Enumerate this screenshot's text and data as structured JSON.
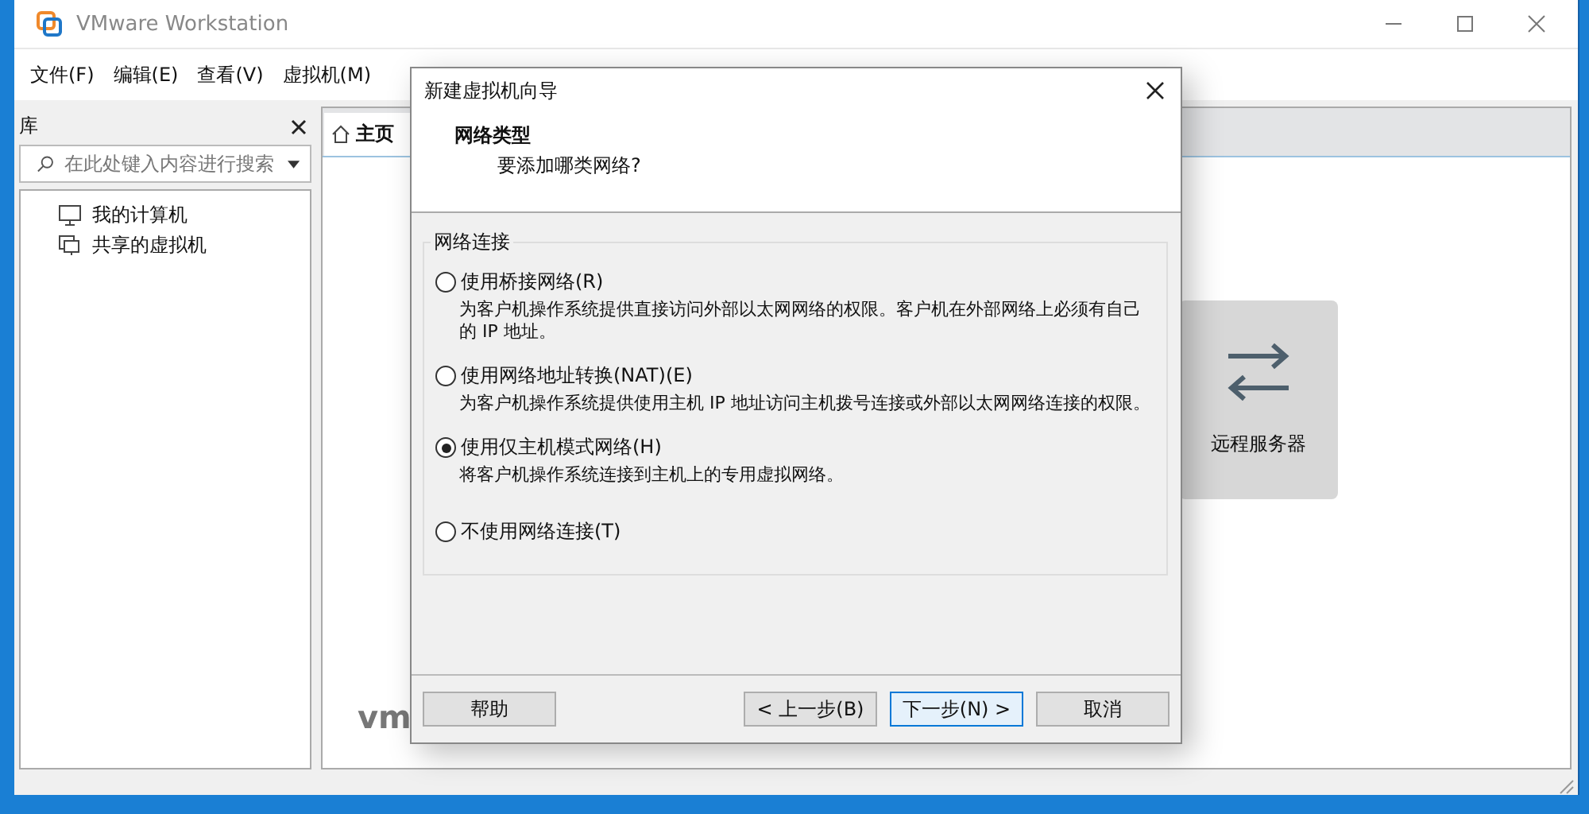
{
  "window": {
    "title": "VMware Workstation"
  },
  "menu": [
    "文件(F)",
    "编辑(E)",
    "查看(V)",
    "虚拟机(M)"
  ],
  "library": {
    "title": "库",
    "search": {
      "placeholder": "在此处键入内容进行搜索"
    },
    "items": [
      {
        "label": "我的计算机",
        "kind": "computer"
      },
      {
        "label": "共享的虚拟机",
        "kind": "shared"
      }
    ]
  },
  "tabs": [
    {
      "label": "主页",
      "selected": true
    }
  ],
  "home": {
    "cards": [
      {
        "label": "远程服务器"
      }
    ],
    "logo": "vm"
  },
  "dialog": {
    "title": "新建虚拟机向导",
    "heading": "网络类型",
    "subheading": "要添加哪类网络?",
    "group": "网络连接",
    "options": [
      {
        "label": "使用桥接网络(R)",
        "description": "为客户机操作系统提供直接访问外部以太网网络的权限。客户机在外部网络上必须有自己的 IP 地址。",
        "selected": false
      },
      {
        "label": "使用网络地址转换(NAT)(E)",
        "description": "为客户机操作系统提供使用主机 IP 地址访问主机拨号连接或外部以太网网络连接的权限。",
        "selected": false
      },
      {
        "label": "使用仅主机模式网络(H)",
        "description": "将客户机操作系统连接到主机上的专用虚拟网络。",
        "selected": true
      },
      {
        "label": "不使用网络连接(T)",
        "selected": false
      }
    ],
    "buttons": [
      {
        "label": "帮助",
        "kind": "help",
        "focused": false
      },
      {
        "label": "< 上一步(B)",
        "kind": "back",
        "focused": false
      },
      {
        "label": "下一步(N) >",
        "kind": "next",
        "focused": true
      },
      {
        "label": "取消",
        "kind": "cancel",
        "focused": false
      }
    ]
  }
}
